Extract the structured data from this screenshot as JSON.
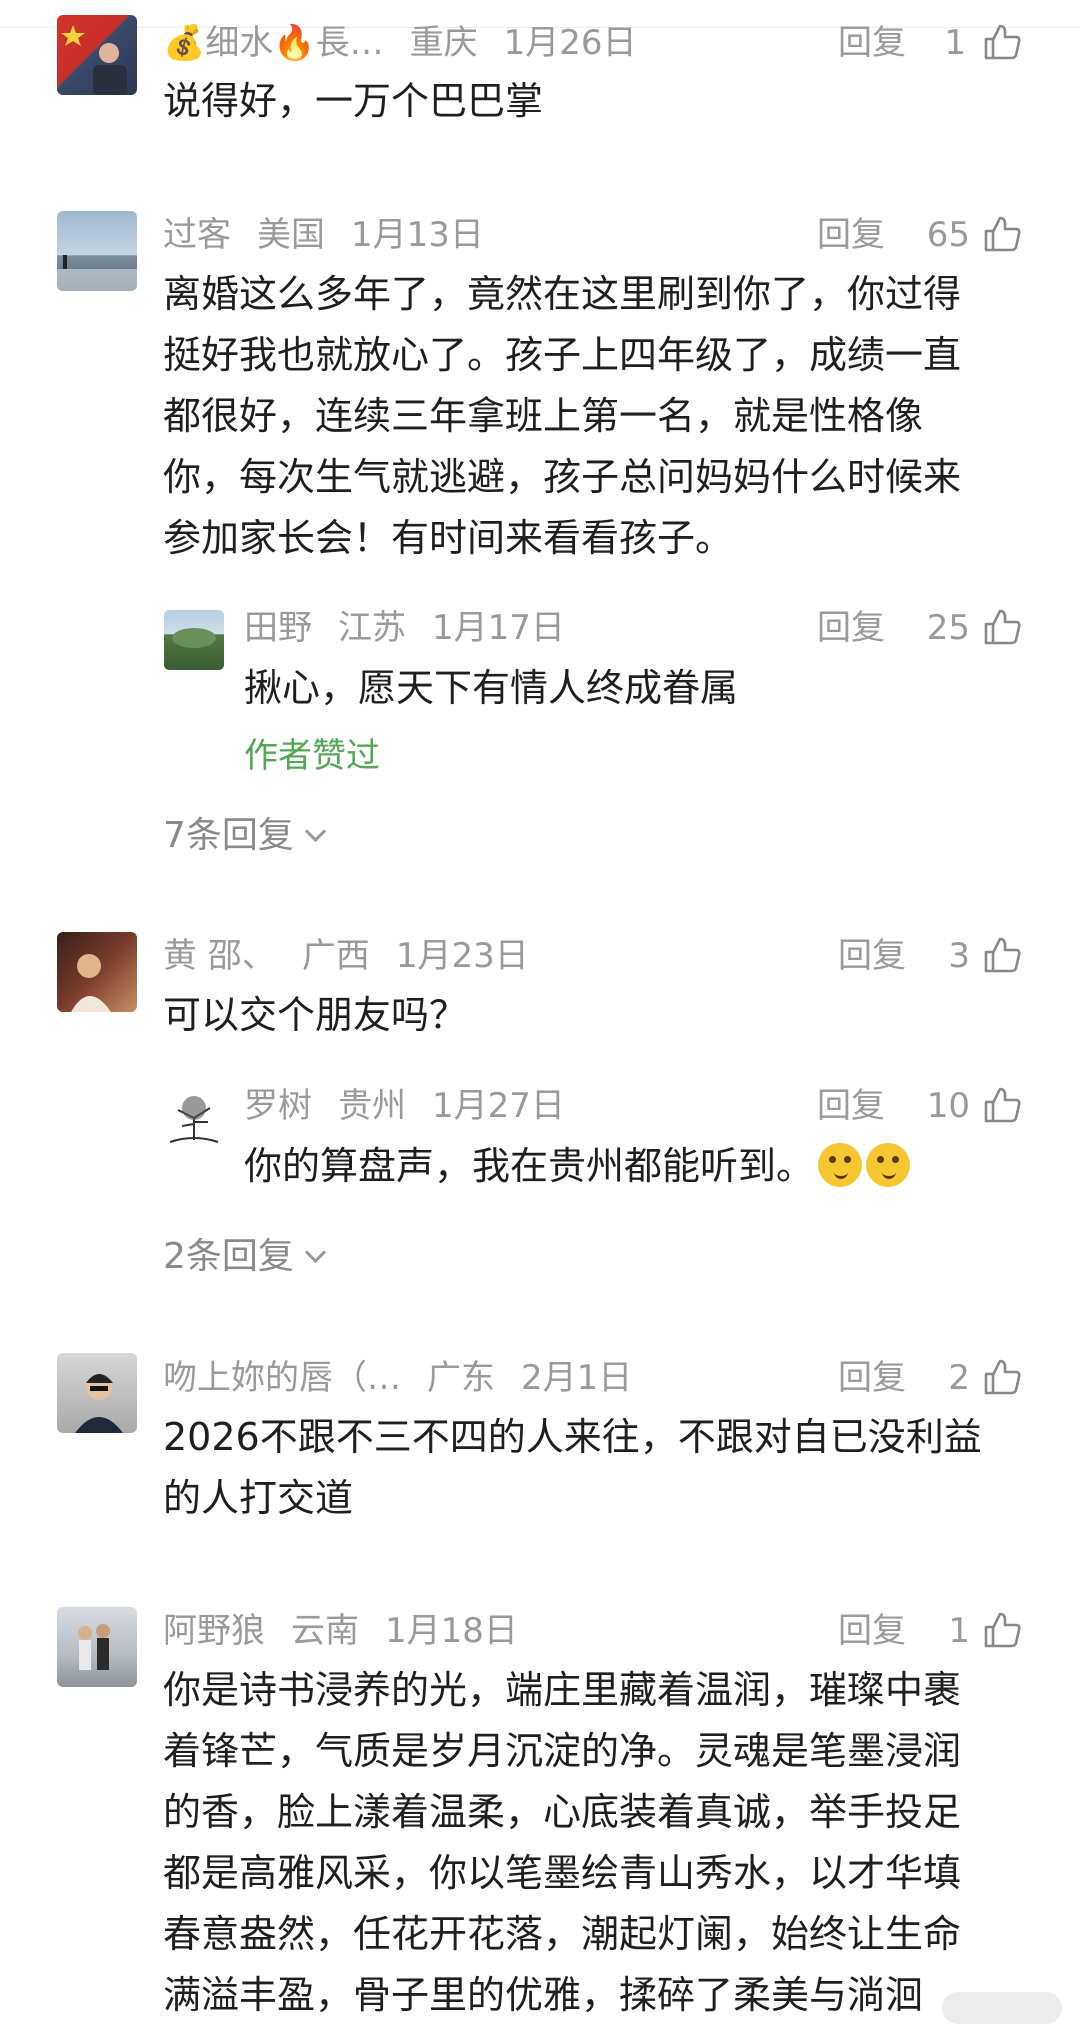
{
  "colors": {
    "meta": "#9a9a9a",
    "text": "#1f1f1f",
    "author_liked": "#52a854"
  },
  "comments": [
    {
      "user": "💰细水🔥長…",
      "location": "重庆",
      "date": "1月26日",
      "reply": "回复",
      "likes": "1",
      "text": [
        "说得好，一万个巴巴掌"
      ]
    },
    {
      "user": "过客",
      "location": "美国",
      "date": "1月13日",
      "reply": "回复",
      "likes": "65",
      "text": [
        "离婚这么多年了，竟然在这里刷到你了，你过得",
        "挺好我也就放心了。孩子上四年级了，成绩一直",
        "都很好，连续三年拿班上第一名，就是性格像",
        "你，每次生气就逃避，孩子总问妈妈什么时候来",
        "参加家长会！有时间来看看孩子。"
      ],
      "sub": {
        "user": "田野",
        "location": "江苏",
        "date": "1月17日",
        "reply": "回复",
        "likes": "25",
        "text": "揪心，愿天下有情人终成眷属",
        "author_liked": "作者赞过"
      },
      "more": "7条回复"
    },
    {
      "user": "黄 邵、",
      "location": "广西",
      "date": "1月23日",
      "reply": "回复",
      "likes": "3",
      "text": [
        "可以交个朋友吗？"
      ],
      "sub": {
        "user": "罗树",
        "location": "贵州",
        "date": "1月27日",
        "reply": "回复",
        "likes": "10",
        "text": "你的算盘声，我在贵州都能听到。"
      },
      "more": "2条回复"
    },
    {
      "user": "吻上妳的唇（…",
      "location": "广东",
      "date": "2月1日",
      "reply": "回复",
      "likes": "2",
      "text": [
        "2026不跟不三不四的人来往，不跟对自已没利益",
        "的人打交道"
      ]
    },
    {
      "user": "阿野狼",
      "location": "云南",
      "date": "1月18日",
      "reply": "回复",
      "likes": "1",
      "text": [
        "你是诗书浸养的光，端庄里藏着温润，璀璨中裹",
        "着锋芒，气质是岁月沉淀的净。灵魂是笔墨浸润",
        "的香，脸上漾着温柔，心底装着真诚，举手投足",
        "都是高雅风采，你以笔墨绘青山秀水，以才华填",
        "春意盎然，任花开花落，潮起灯阑，始终让生命",
        "满溢丰盈，骨子里的优雅，揉碎了柔美与淌洄"
      ]
    }
  ]
}
